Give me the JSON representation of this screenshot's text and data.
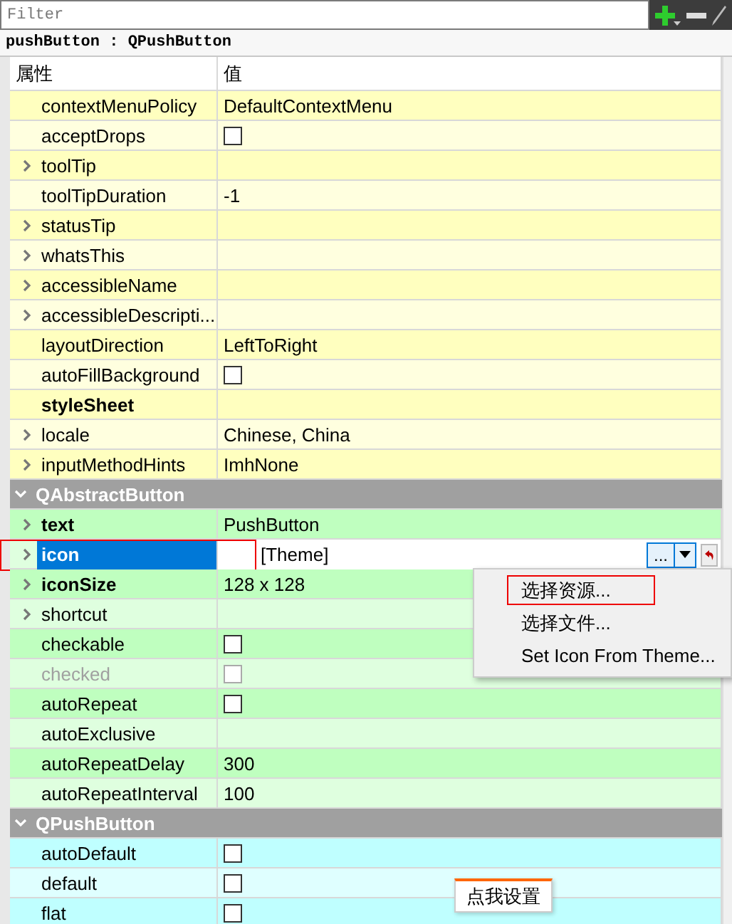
{
  "filter": {
    "placeholder": "Filter"
  },
  "object_label": "pushButton : QPushButton",
  "columns": [
    "属性",
    "值"
  ],
  "groups": [
    {
      "color": "#ffffbf",
      "rows": [
        {
          "name": "contextMenuPolicy",
          "kind": "text",
          "value": "DefaultContextMenu",
          "expandable": false,
          "modified": false,
          "disabled": false,
          "selected": false,
          "highlighted": false
        },
        {
          "name": "acceptDrops",
          "kind": "checkbox",
          "checked": false,
          "expandable": false,
          "modified": false,
          "disabled": false,
          "selected": false,
          "highlighted": false
        },
        {
          "name": "toolTip",
          "kind": "text",
          "expandable": true,
          "modified": false,
          "disabled": false,
          "selected": false,
          "highlighted": false
        },
        {
          "name": "toolTipDuration",
          "kind": "text",
          "value": "-1",
          "expandable": false,
          "modified": false,
          "disabled": false,
          "selected": false,
          "highlighted": false
        },
        {
          "name": "statusTip",
          "kind": "text",
          "expandable": true,
          "modified": false,
          "disabled": false,
          "selected": false,
          "highlighted": false
        },
        {
          "name": "whatsThis",
          "kind": "text",
          "expandable": true,
          "modified": false,
          "disabled": false,
          "selected": false,
          "highlighted": false
        },
        {
          "name": "accessibleName",
          "kind": "text",
          "expandable": true,
          "modified": false,
          "disabled": false,
          "selected": false,
          "highlighted": false
        },
        {
          "name": "accessibleDescripti...",
          "kind": "text",
          "expandable": true,
          "modified": false,
          "disabled": false,
          "selected": false,
          "highlighted": false
        },
        {
          "name": "layoutDirection",
          "kind": "text",
          "value": "LeftToRight",
          "expandable": false,
          "modified": false,
          "disabled": false,
          "selected": false,
          "highlighted": false
        },
        {
          "name": "autoFillBackground",
          "kind": "checkbox",
          "checked": false,
          "expandable": false,
          "modified": false,
          "disabled": false,
          "selected": false,
          "highlighted": false
        },
        {
          "name": "styleSheet",
          "kind": "text",
          "expandable": false,
          "modified": true,
          "disabled": false,
          "selected": false,
          "highlighted": false
        },
        {
          "name": "locale",
          "kind": "text",
          "value": "Chinese, China",
          "expandable": true,
          "modified": false,
          "disabled": false,
          "selected": false,
          "highlighted": false
        },
        {
          "name": "inputMethodHints",
          "kind": "text",
          "value": "ImhNone",
          "expandable": true,
          "modified": false,
          "disabled": false,
          "selected": false,
          "highlighted": false
        }
      ]
    },
    {
      "title": "QAbstractButton",
      "expanded": true,
      "color": "#bfffbf",
      "rows": [
        {
          "name": "text",
          "kind": "text",
          "value": "PushButton",
          "expandable": true,
          "modified": true,
          "disabled": false,
          "selected": false,
          "highlighted": false
        },
        {
          "name": "icon",
          "kind": "editor",
          "value": "[Theme]",
          "button": "...",
          "expandable": true,
          "modified": true,
          "disabled": false,
          "selected": true,
          "highlighted": true
        },
        {
          "name": "iconSize",
          "kind": "text",
          "value": "128 x 128",
          "expandable": true,
          "modified": true,
          "disabled": false,
          "selected": false,
          "highlighted": false
        },
        {
          "name": "shortcut",
          "kind": "text",
          "expandable": true,
          "modified": false,
          "disabled": false,
          "selected": false,
          "highlighted": false
        },
        {
          "name": "checkable",
          "kind": "checkbox",
          "checked": false,
          "expandable": false,
          "modified": false,
          "disabled": false,
          "selected": false,
          "highlighted": false
        },
        {
          "name": "checked",
          "kind": "checkbox",
          "checked": false,
          "expandable": false,
          "modified": false,
          "disabled": true,
          "selected": false,
          "highlighted": false
        },
        {
          "name": "autoRepeat",
          "kind": "checkbox",
          "checked": false,
          "expandable": false,
          "modified": false,
          "disabled": false,
          "selected": false,
          "highlighted": false
        },
        {
          "name": "autoExclusive",
          "kind": "text",
          "expandable": false,
          "modified": false,
          "disabled": false,
          "selected": false,
          "highlighted": false
        },
        {
          "name": "autoRepeatDelay",
          "kind": "text",
          "value": "300",
          "expandable": false,
          "modified": false,
          "disabled": false,
          "selected": false,
          "highlighted": false
        },
        {
          "name": "autoRepeatInterval",
          "kind": "text",
          "value": "100",
          "expandable": false,
          "modified": false,
          "disabled": false,
          "selected": false,
          "highlighted": false
        }
      ]
    },
    {
      "title": "QPushButton",
      "expanded": true,
      "color": "#bfffff",
      "rows": [
        {
          "name": "autoDefault",
          "kind": "checkbox",
          "checked": false,
          "expandable": false,
          "modified": false,
          "disabled": false,
          "selected": false,
          "highlighted": false
        },
        {
          "name": "default",
          "kind": "checkbox",
          "checked": false,
          "expandable": false,
          "modified": false,
          "disabled": false,
          "selected": false,
          "highlighted": false
        },
        {
          "name": "flat",
          "kind": "checkbox",
          "checked": false,
          "expandable": false,
          "modified": false,
          "disabled": false,
          "selected": false,
          "highlighted": false
        }
      ]
    }
  ],
  "menu": {
    "items": [
      {
        "label": "选择资源...",
        "highlighted": true
      },
      {
        "label": "选择文件...",
        "highlighted": false
      },
      {
        "label": "Set Icon From Theme...",
        "highlighted": false
      }
    ]
  },
  "tooltip": {
    "text": "点我设置"
  }
}
